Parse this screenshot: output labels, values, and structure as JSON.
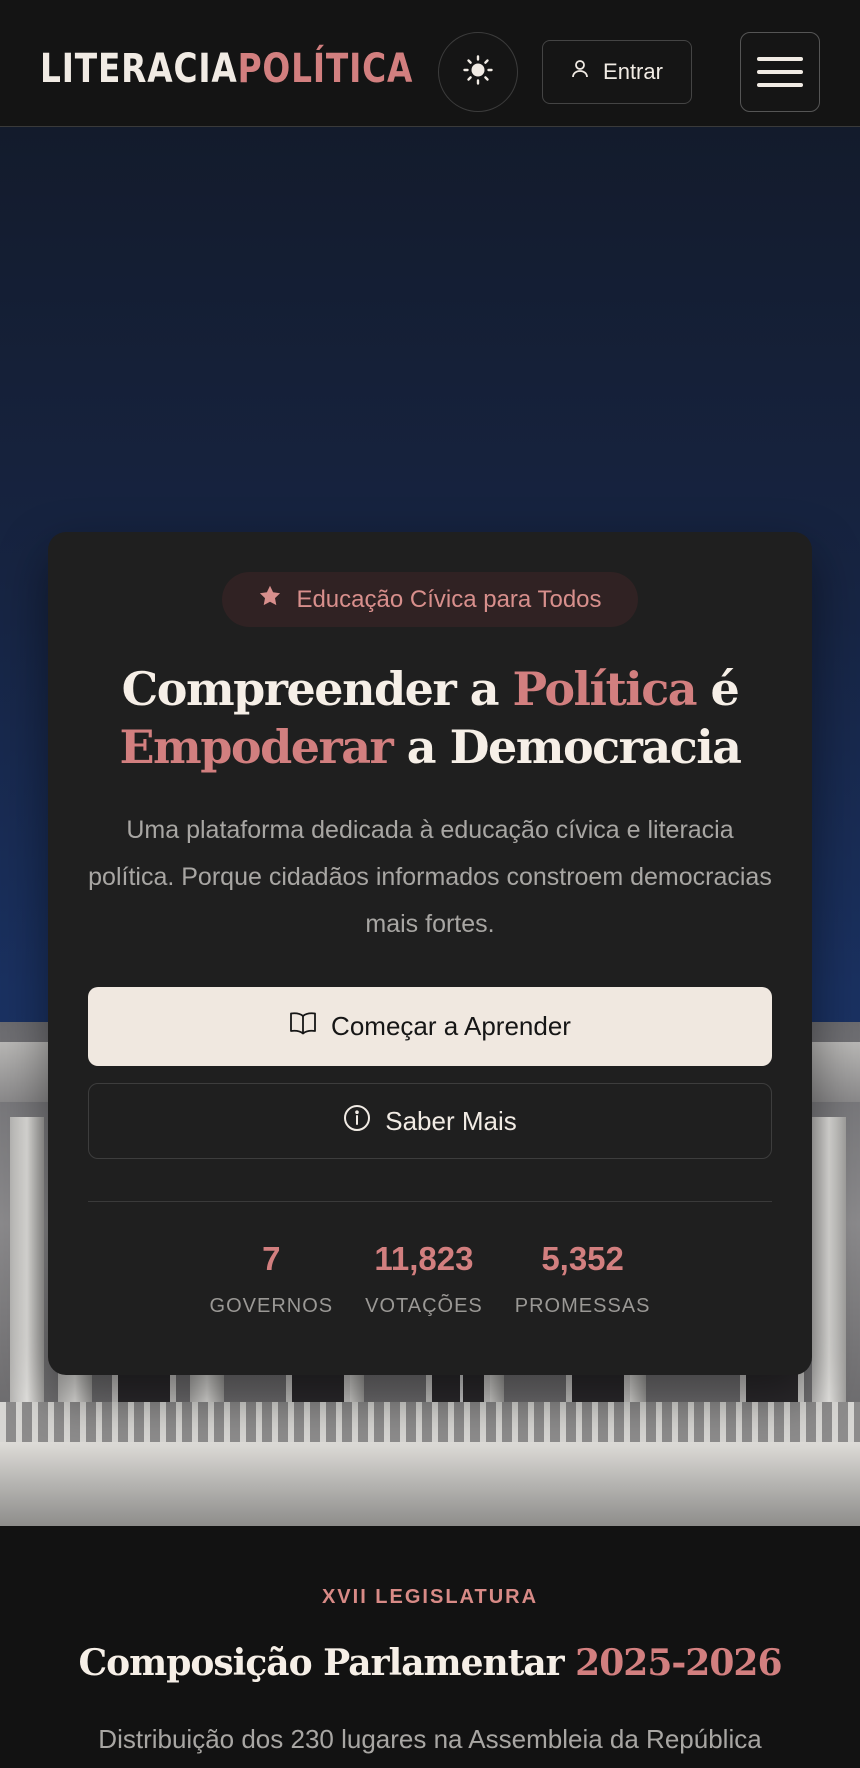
{
  "header": {
    "logo_part1": "LITERACIA",
    "logo_part2": "POLÍTICA",
    "theme_toggle_icon": "sun-icon",
    "login_label": "Entrar",
    "login_icon": "user-icon",
    "menu_icon": "hamburger-menu-icon"
  },
  "hero": {
    "badge": "Educação Cívica para Todos",
    "badge_icon": "star-icon",
    "title": {
      "part1": "Compreender a ",
      "accent1": "Política",
      "part2": " é",
      "accent2": "Empoderar",
      "part3": " a Democracia"
    },
    "description": "Uma plataforma dedicada à educação cívica e literacia política. Porque cidadãos informados constroem democracias mais fortes.",
    "primary_button": "Começar a Aprender",
    "primary_button_icon": "book-open-icon",
    "secondary_button": "Saber Mais",
    "secondary_button_icon": "info-icon",
    "stats": [
      {
        "value": "7",
        "label": "GOVERNOS"
      },
      {
        "value": "11,823",
        "label": "VOTAÇÕES"
      },
      {
        "value": "5,352",
        "label": "PROMESSAS"
      }
    ],
    "background": "parliament-building-photo"
  },
  "section": {
    "eyebrow": "XVII LEGISLATURA",
    "title": "Composição Parlamentar ",
    "title_accent": "2025-2026",
    "description": "Distribuição dos 230 lugares na Assembleia da República"
  },
  "colors": {
    "accent": "#d27f7f",
    "background": "#121212",
    "card": "#1f1f1f",
    "primary_button_bg": "#f0e8e0"
  }
}
